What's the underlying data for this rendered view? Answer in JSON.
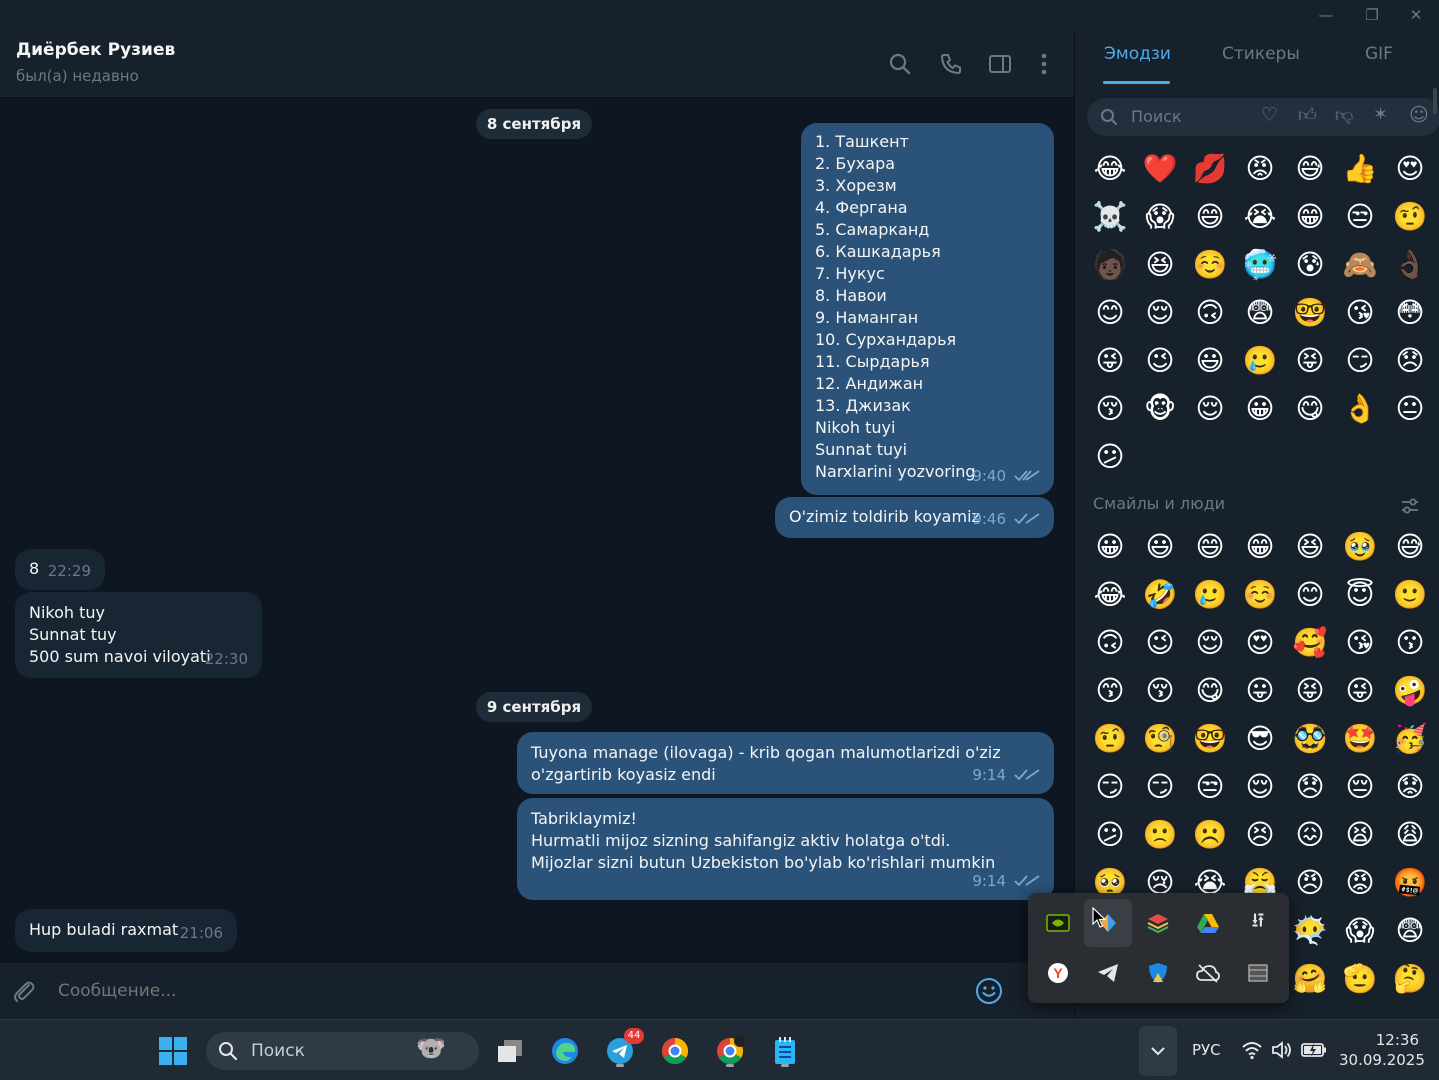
{
  "window": {
    "minimize": "—",
    "maximize": "❐",
    "close": "✕"
  },
  "header": {
    "name": "Диёрбек Рузиев",
    "status": "был(а) недавно"
  },
  "dates": {
    "d1": "8 сентября",
    "d2": "9 сентября"
  },
  "messages": {
    "m1": {
      "lines": [
        "1. Ташкент",
        "2. Бухара",
        "3. Хорезм",
        "4. Фергана",
        "5. Самарканд",
        "6. Кашкадарья",
        "7. Нукус",
        "8. Навои",
        "9. Наманган",
        "10. Сурхандарья",
        "11. Сырдарья",
        "12. Андижан",
        "13. Джизак",
        "Nikoh tuyi",
        "Sunnat tuyi",
        "Narxlarini yozvoring"
      ],
      "time": "9:40"
    },
    "m2": {
      "lines": [
        "O'zimiz toldirib koyamiz"
      ],
      "time": "9:46"
    },
    "m3": {
      "lines": [
        "8"
      ],
      "time": "22:29"
    },
    "m4": {
      "lines": [
        "Nikoh tuy",
        "Sunnat tuy",
        "500 sum navoi viloyati"
      ],
      "time": "22:30"
    },
    "m5": {
      "lines": [
        "Tuyona manage (ilovaga) - krib qogan malumotlarizdi o'ziz",
        "o'zgartirib koyasiz endi"
      ],
      "time": "9:14"
    },
    "m6": {
      "lines": [
        "Tabriklaymiz!",
        "Hurmatli mijoz sizning sahifangiz aktiv holatga o'tdi.",
        "Mijozlar sizni butun Uzbekiston bo'ylab ko'rishlari mumkin"
      ],
      "time": "9:14"
    },
    "m7": {
      "lines": [
        "Hup buladi raxmat"
      ],
      "time": "21:06"
    }
  },
  "composer": {
    "placeholder": "Сообщение..."
  },
  "panel": {
    "tabs": [
      "Эмодзи",
      "Стикеры",
      "GIF"
    ],
    "search_placeholder": "Поиск",
    "section_title": "Смайлы и люди",
    "recent": [
      "😂",
      "❤️",
      "💋",
      "😡",
      "😅",
      "👍",
      "😍",
      "☠️",
      "😱",
      "😄",
      "😭",
      "😁",
      "😒",
      "🤨",
      "🧑🏿",
      "😆",
      "☺️",
      "🥶",
      "😰",
      "🙈",
      "👌🏿",
      "😊",
      "😌",
      "🙃",
      "😨",
      "🤓",
      "😘",
      "😳",
      "😜",
      "😉",
      "😃",
      "🥲",
      "😝",
      "😏",
      "😞",
      "😚",
      "🐵",
      "😌",
      "😀",
      "😋",
      "👌",
      "😐",
      "😕"
    ],
    "smileys": [
      "😀",
      "😃",
      "😄",
      "😁",
      "😆",
      "🥹",
      "😅",
      "😂",
      "🤣",
      "🥲",
      "☺️",
      "😊",
      "😇",
      "🙂",
      "🙃",
      "😉",
      "😌",
      "😍",
      "🥰",
      "😘",
      "😗",
      "😙",
      "😚",
      "😋",
      "😛",
      "😝",
      "😜",
      "🤪",
      "🤨",
      "🧐",
      "🤓",
      "😎",
      "🥸",
      "🤩",
      "🥳",
      "😏",
      "😏",
      "😒",
      "😌",
      "😞",
      "😔",
      "😟",
      "😕",
      "🙁",
      "☹️",
      "😣",
      "😖",
      "😫",
      "😩",
      "🥺",
      "😢",
      "😭",
      "😤",
      "😠",
      "😡",
      "🤬",
      "🤯",
      "😳",
      "🥵",
      "🥶",
      "😶‍🌫️",
      "😱",
      "😨",
      "😰",
      "😥",
      "😓",
      "🫣",
      "🤗",
      "🫡",
      "🤔"
    ]
  },
  "colors": {
    "accent": "#4fa9ea",
    "bubble_out": "#2b5278",
    "bubble_in": "#182533",
    "bg": "#0e1621",
    "panel": "#17212b"
  },
  "taskbar": {
    "search_label": "Поиск",
    "telegram_badge": "44",
    "lang": "РУС",
    "time": "12:36",
    "date": "30.09.2025"
  }
}
